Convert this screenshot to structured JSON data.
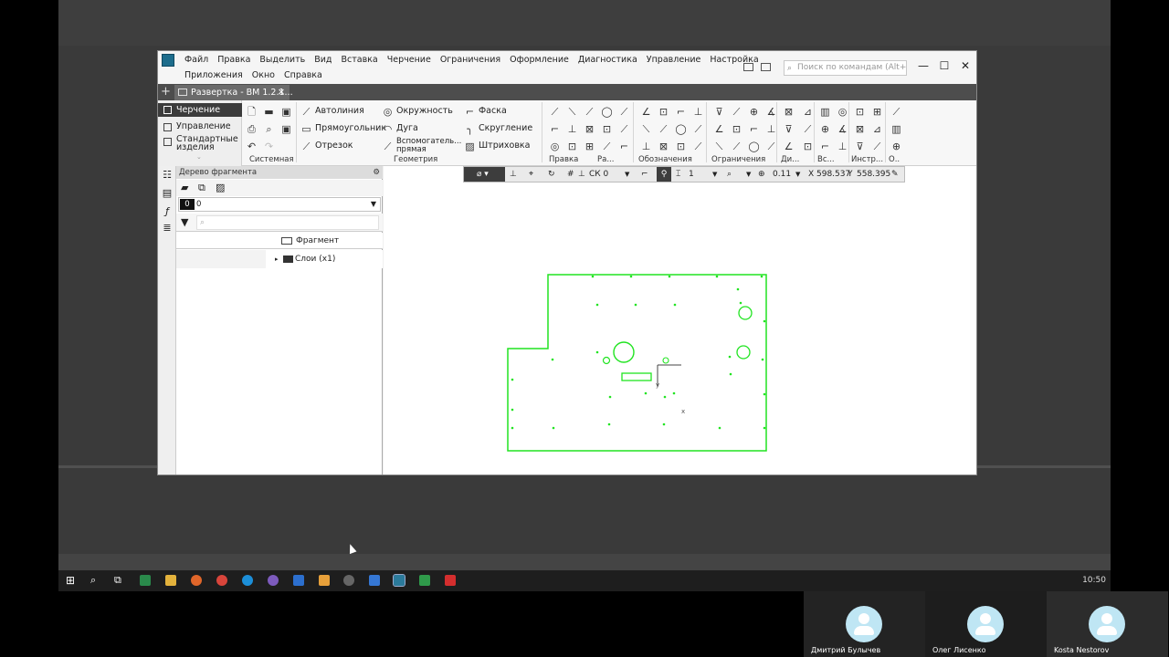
{
  "window": {
    "tab_title": "Развертка - ВМ 1.2.1...",
    "tab_close": "✕",
    "new_tab": "+",
    "search_placeholder": "Поиск по командам (Alt+/)",
    "minimize": "—",
    "maximize": "☐",
    "close": "✕"
  },
  "menu": {
    "row1": [
      "Файл",
      "Правка",
      "Выделить",
      "Вид",
      "Вставка",
      "Черчение",
      "Ограничения",
      "Оформление",
      "Диагностика",
      "Управление",
      "Настройка"
    ],
    "row2": [
      "Приложения",
      "Окно",
      "Справка"
    ]
  },
  "ribbon": {
    "left_items": [
      "Черчение",
      "Управление",
      "Стандартные",
      "изделия"
    ],
    "geometry": {
      "autoline": "Автолиния",
      "rectangle": "Прямоугольник",
      "segment": "Отрезок",
      "circle": "Окружность",
      "arc": "Дуга",
      "auxline_1": "Вспомогатель...",
      "auxline_2": "прямая",
      "chamfer": "Фаска",
      "fillet": "Скругление",
      "hatch": "Штриховка"
    },
    "groups": {
      "system": "Системная",
      "geometry": "Геометрия",
      "edit": "Правка",
      "ra": "Ра...",
      "notation": "Обозначения",
      "constraints": "Ограничения",
      "di": "Ди...",
      "vs": "Вс...",
      "instr": "Инстр...",
      "o": "О.."
    }
  },
  "tree": {
    "header": "Дерево фрагмента",
    "layer_num": "0",
    "layer_value": "0",
    "column_label": "Фрагмент",
    "row_label": "Слои (x1)"
  },
  "float_toolbar": {
    "cs": "СК 0",
    "linestyle": "1",
    "zoom": "0.11",
    "x_label": "X",
    "x_value": "598.537",
    "y_label": "Y",
    "y_value": "558.395"
  },
  "axis_labels": {
    "y": "y",
    "x": "x"
  },
  "taskbar": {
    "clock": "10:50"
  },
  "participants": [
    {
      "name": "Дмитрий Булычев"
    },
    {
      "name": "Олег Лисенко"
    },
    {
      "name": "Kosta Nestorov"
    }
  ],
  "colors": {
    "drawing": "#21e421",
    "accent": "#3c3c3c"
  }
}
